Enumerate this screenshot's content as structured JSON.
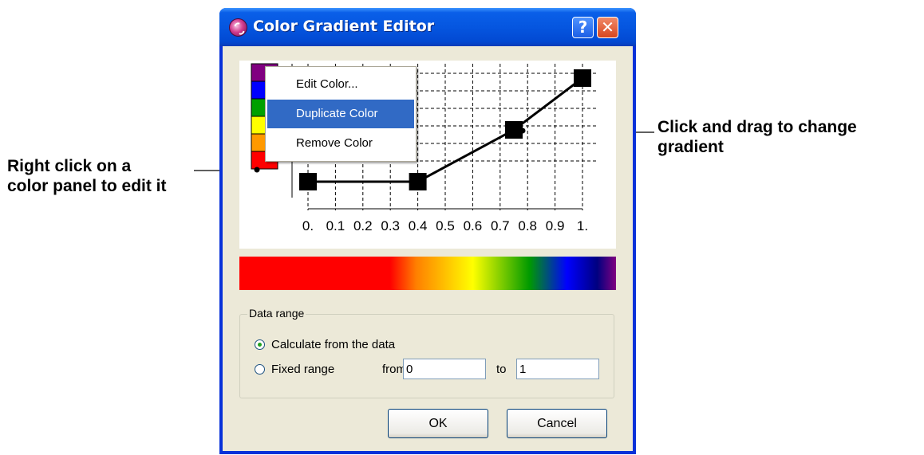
{
  "annotations": {
    "left": "Right click on a\ncolor panel to edit it",
    "right": "Click and drag to change\ngradient"
  },
  "window": {
    "title": "Color Gradient Editor",
    "help_label": "?",
    "close_label": "✕"
  },
  "plot": {
    "x_ticks": [
      "0.",
      "0.1",
      "0.2",
      "0.3",
      "0.4",
      "0.5",
      "0.6",
      "0.7",
      "0.8",
      "0.9",
      "1."
    ],
    "control_points": [
      {
        "x": 0.0,
        "y": 0.0
      },
      {
        "x": 0.4,
        "y": 0.0
      },
      {
        "x": 0.75,
        "y": 0.5
      },
      {
        "x": 1.0,
        "y": 1.0
      }
    ],
    "color_panels": [
      "#800080",
      "#0000ff",
      "#00a000",
      "#ffff00",
      "#ff9900",
      "#ff0000"
    ]
  },
  "context_menu": {
    "items": [
      {
        "label": "Edit Color...",
        "highlighted": false
      },
      {
        "label": "Duplicate Color",
        "highlighted": true
      },
      {
        "label": "Remove Color",
        "highlighted": false
      }
    ],
    "highlight_color": "#316ac5"
  },
  "data_range": {
    "title": "Data range",
    "option_calculate": "Calculate from the data",
    "option_fixed": "Fixed range",
    "selected": "calculate",
    "from_label": "from",
    "from_value": "0",
    "to_label": "to",
    "to_value": "1"
  },
  "buttons": {
    "ok": "OK",
    "cancel": "Cancel"
  }
}
